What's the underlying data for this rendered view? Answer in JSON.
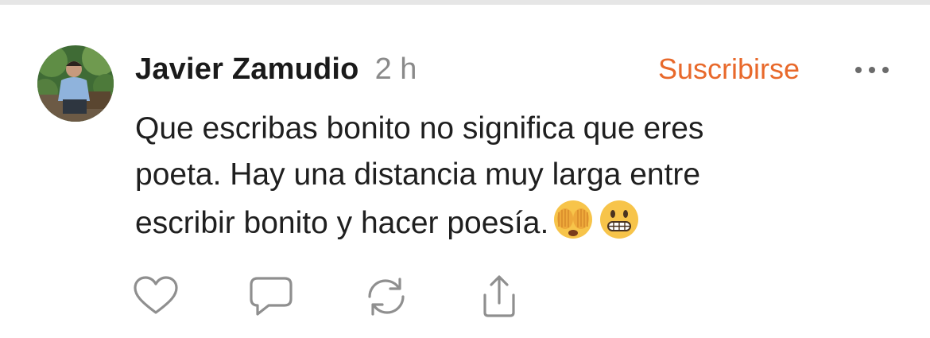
{
  "post": {
    "author": "Javier Zamudio",
    "time": "2 h",
    "subscribe_label": "Suscribirse",
    "body_lines": [
      "Que escribas bonito no significa que eres",
      "poeta. Hay una distancia muy larga entre",
      "escribir bonito y hacer poesía."
    ],
    "emojis": [
      "face-with-hands-over-eyes",
      "grimacing-face"
    ]
  },
  "actions": [
    {
      "icon": "heart-icon"
    },
    {
      "icon": "comment-icon"
    },
    {
      "icon": "repost-icon"
    },
    {
      "icon": "share-icon"
    }
  ],
  "colors": {
    "accent": "#e8692b",
    "text": "#1f1f1f",
    "muted": "#8a8a8a",
    "icon": "#8f8f8f"
  }
}
